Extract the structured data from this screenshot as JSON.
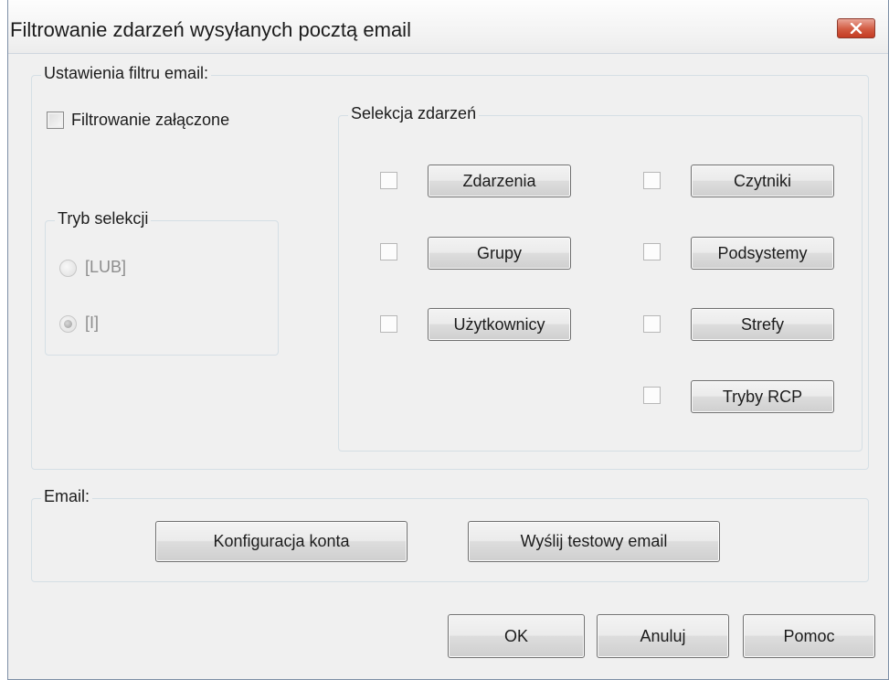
{
  "window": {
    "title": "Filtrowanie zdarzeń wysyłanych pocztą email"
  },
  "filter_settings": {
    "label": "Ustawienia filtru email:",
    "filter_enabled_label": "Filtrowanie załączone",
    "filter_enabled": false,
    "mode": {
      "label": "Tryb selekcji",
      "options": [
        {
          "label": "[LUB]",
          "selected": false
        },
        {
          "label": "[I]",
          "selected": true
        }
      ]
    },
    "selection": {
      "label": "Selekcja zdarzeń",
      "left_buttons": [
        "Zdarzenia",
        "Grupy",
        "Użytkownicy"
      ],
      "right_buttons": [
        "Czytniki",
        "Podsystemy",
        "Strefy",
        "Tryby RCP"
      ]
    }
  },
  "email": {
    "label": "Email:",
    "config_button": "Konfiguracja konta",
    "test_button": "Wyślij testowy email"
  },
  "footer": {
    "ok": "OK",
    "cancel": "Anuluj",
    "help": "Pomoc"
  },
  "colors": {
    "close_button": "#c43b22",
    "groupbox_border": "#d5dfe5",
    "window_bg": "#f0f0f0"
  }
}
